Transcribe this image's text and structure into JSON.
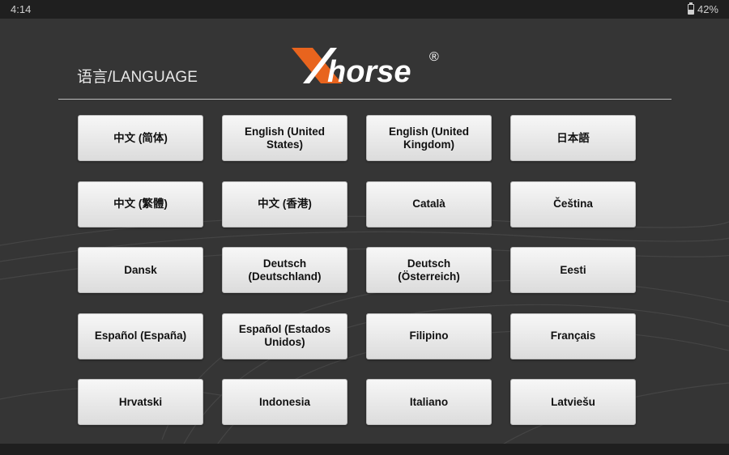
{
  "status_bar": {
    "time": "4:14",
    "battery": "42%",
    "battery_level": 0.42
  },
  "header": {
    "title": "语言/LANGUAGE",
    "logo_text": "Xhorse",
    "logo_mark": "®"
  },
  "languages": [
    {
      "label": "中文 (简体)"
    },
    {
      "label": "English (United States)"
    },
    {
      "label": "English (United Kingdom)"
    },
    {
      "label": "日本語"
    },
    {
      "label": "中文 (繁體)"
    },
    {
      "label": "中文 (香港)"
    },
    {
      "label": "Català"
    },
    {
      "label": "Čeština"
    },
    {
      "label": "Dansk"
    },
    {
      "label": "Deutsch (Deutschland)"
    },
    {
      "label": "Deutsch (Österreich)"
    },
    {
      "label": "Eesti"
    },
    {
      "label": "Español (España)"
    },
    {
      "label": "Español (Estados Unidos)"
    },
    {
      "label": "Filipino"
    },
    {
      "label": "Français"
    },
    {
      "label": "Hrvatski"
    },
    {
      "label": "Indonesia"
    },
    {
      "label": "Italiano"
    },
    {
      "label": "Latviešu"
    }
  ],
  "colors": {
    "logo_orange": "#e8641e",
    "logo_white": "#ffffff",
    "background": "#353535"
  }
}
